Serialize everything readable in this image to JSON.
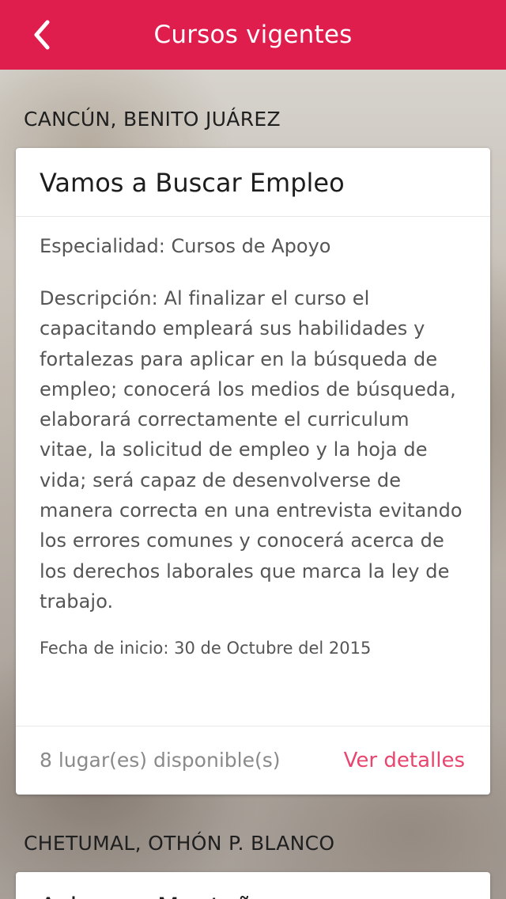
{
  "header": {
    "title": "Cursos vigentes",
    "back_icon": "chevron-left-icon",
    "background_color": "#e01e4d"
  },
  "sections": [
    {
      "location": "CANCÚN, BENITO JUÁREZ",
      "course": {
        "title": "Vamos a Buscar Empleo",
        "specialty": "Especialidad: Cursos de Apoyo",
        "description": "Descripción: Al finalizar el curso el capacitando empleará sus habilidades y fortalezas para aplicar en la búsqueda de empleo; conocerá los medios de búsqueda, elaborará correctamente el curriculum vitae, la solicitud de empleo y la hoja de vida; será capaz de desenvolverse de manera correcta en una entrevista evitando los errores comunes y conocerá acerca de los derechos laborales que marca la ley de trabajo.",
        "start_date": "Fecha de inicio: 30 de Octubre del 2015",
        "seats": "8 lugar(es) disponible(s)",
        "details_link": "Ver detalles"
      }
    },
    {
      "location": "CHETUMAL, OTHÓN P. BLANCO",
      "course": {
        "title": "Ashanga Montaña"
      }
    }
  ],
  "colors": {
    "accent": "#e01e4d",
    "link": "#e8456f"
  }
}
